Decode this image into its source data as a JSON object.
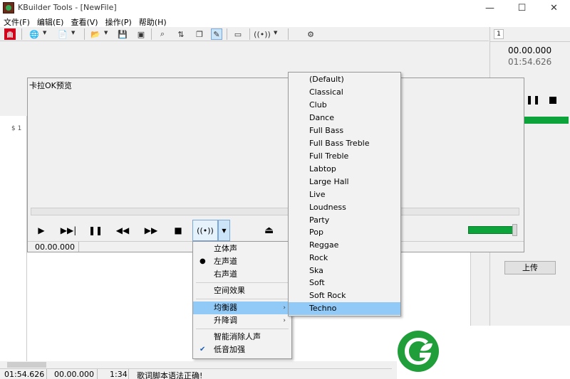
{
  "window": {
    "title": "KBuilder Tools - [NewFile]",
    "minimize": "—",
    "maximize": "☐",
    "close": "✕"
  },
  "menubar": [
    "文件(F)",
    "编辑(E)",
    "查看(V)",
    "操作(P)",
    "帮助(H)"
  ],
  "toolbar": {
    "app_button": "曲"
  },
  "left_gutter": "$ 1",
  "right_panel": {
    "tab_number": "1",
    "time_current": "00.00.000",
    "time_total": "01:54.626",
    "upload_label": "上传",
    "level_fraction": 1.0
  },
  "karaoke": {
    "title": "卡拉OK预览",
    "time": "00.00.000",
    "volume_fraction": 1.0,
    "progress_fraction": 0.0
  },
  "context_menu": {
    "items": [
      {
        "label": "立体声",
        "checked": false,
        "bullet": false,
        "submenu": false,
        "highlight": false
      },
      {
        "label": "左声道",
        "checked": false,
        "bullet": true,
        "submenu": false,
        "highlight": false
      },
      {
        "label": "右声道",
        "checked": false,
        "bullet": false,
        "submenu": false,
        "highlight": false
      },
      {
        "label": "空间效果",
        "checked": false,
        "bullet": false,
        "submenu": false,
        "highlight": false
      },
      {
        "label": "均衡器",
        "checked": false,
        "bullet": false,
        "submenu": true,
        "highlight": true
      },
      {
        "label": "升降调",
        "checked": false,
        "bullet": false,
        "submenu": true,
        "highlight": false
      },
      {
        "label": "智能消除人声",
        "checked": false,
        "bullet": false,
        "submenu": false,
        "highlight": false
      },
      {
        "label": "低音加强",
        "checked": true,
        "bullet": false,
        "submenu": false,
        "highlight": false
      }
    ]
  },
  "equalizer_menu": {
    "items": [
      "(Default)",
      "Classical",
      "Club",
      "Dance",
      "Full Bass",
      "Full Bass  Treble",
      "Full Treble",
      "Labtop",
      "Large Hall",
      "Live",
      "Loudness",
      "Party",
      "Pop",
      "Reggae",
      "Rock",
      "Ska",
      "Soft",
      "Soft Rock",
      "Techno"
    ],
    "selected": "Techno"
  },
  "statusbar": {
    "total": "01:54.626",
    "current": "00.00.000",
    "line": "1:34",
    "message": "歌词脚本语法正确!"
  },
  "colors": {
    "accent_green": "#0ca43a",
    "highlight_blue": "#91c9f7",
    "logo_green": "#1f9e3a"
  }
}
